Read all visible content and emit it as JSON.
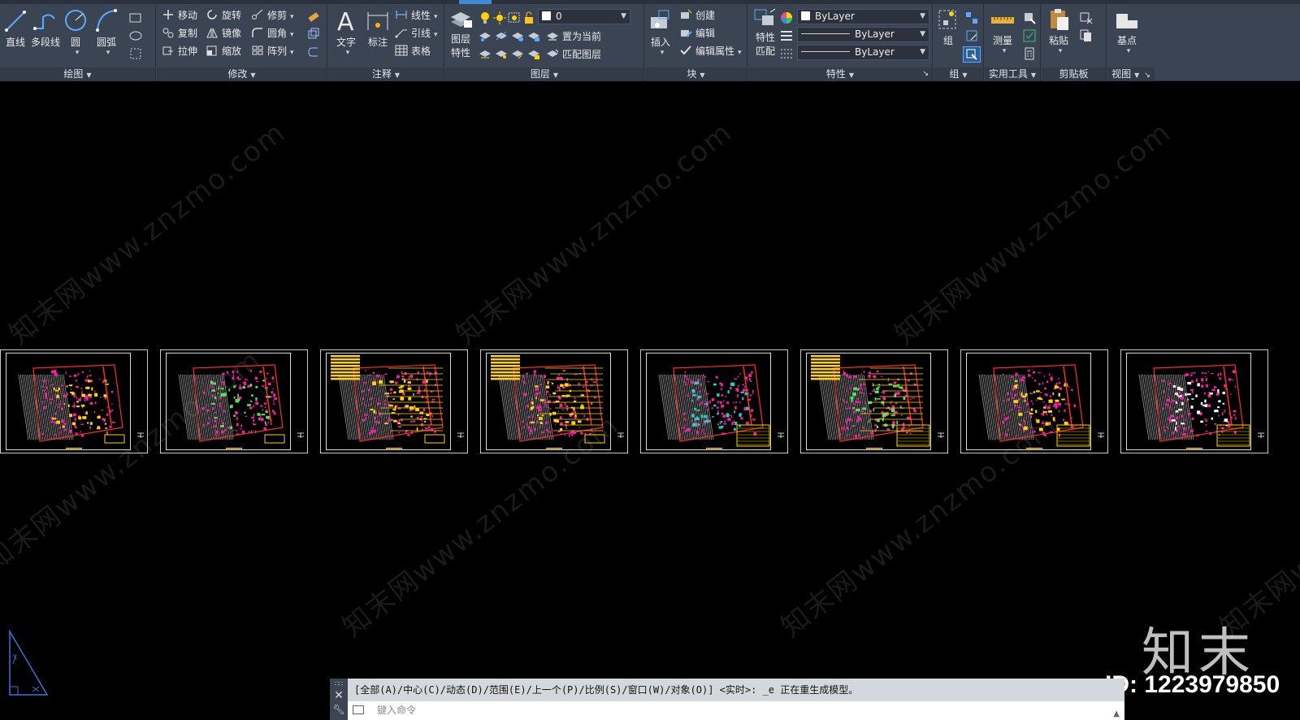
{
  "ribbon": {
    "draw": {
      "line": "直线",
      "polyline": "多段线",
      "circle": "圆",
      "arc": "圆弧",
      "footer": "绘图"
    },
    "modify": {
      "move": "移动",
      "rotate": "旋转",
      "trim": "修剪",
      "copy": "复制",
      "mirror": "镜像",
      "fillet": "圆角",
      "stretch": "拉伸",
      "scale": "缩放",
      "array": "阵列",
      "footer": "修改"
    },
    "annotation": {
      "text": "文字",
      "dimension": "标注",
      "linear": "线性",
      "leader": "引线",
      "table": "表格",
      "footer": "注释"
    },
    "layers": {
      "layer_props_1": "图层",
      "layer_props_2": "特性",
      "layer_value": "0",
      "set_current": "置为当前",
      "match_layer": "匹配图层",
      "footer": "图层"
    },
    "block": {
      "insert": "插入",
      "create": "创建",
      "edit": "编辑",
      "edit_attr": "编辑属性",
      "footer": "块"
    },
    "properties": {
      "match_1": "特性",
      "match_2": "匹配",
      "color": "ByLayer",
      "linetype": "ByLayer",
      "lineweight": "ByLayer",
      "footer": "特性"
    },
    "groups": {
      "group": "组",
      "footer": "组"
    },
    "utilities": {
      "measure": "测量",
      "footer": "实用工具"
    },
    "clipboard": {
      "paste": "粘贴",
      "footer": "剪贴板"
    },
    "view": {
      "basepoint": "基点",
      "footer": "视图"
    }
  },
  "sheet_count": 8,
  "watermark_text": "知末网www.znzmo.com",
  "command": {
    "history": "[全部(A)/中心(C)/动态(D)/范围(E)/上一个(P)/比例(S)/窗口(W)/对象(O)] <实时>: _e 正在重生成模型。",
    "placeholder": "键入命令"
  },
  "brand": {
    "name": "知末",
    "id": "ID: 1223979850"
  },
  "colors": {
    "ribbon": "#3b4453",
    "accent": "#3d8ad6",
    "magenta": "#ff1aa8",
    "yellow": "#ffd400",
    "red": "#ff2a2a",
    "green": "#54e05a",
    "cyan": "#19d3c5"
  }
}
